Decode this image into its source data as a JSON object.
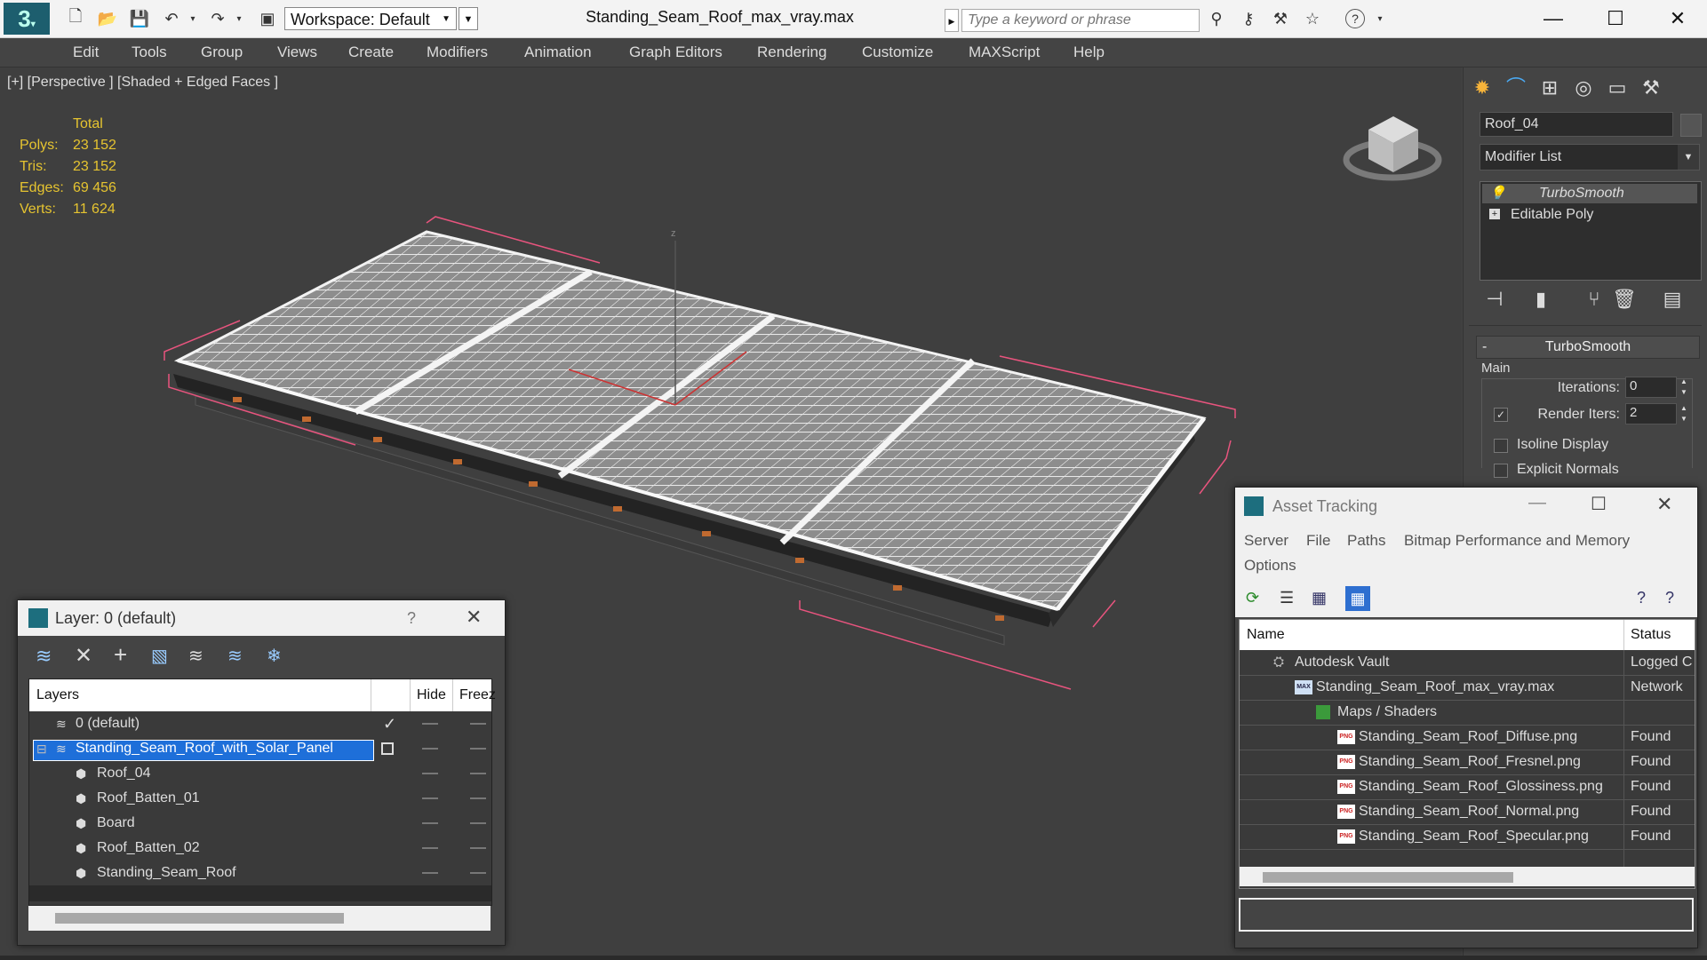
{
  "titlebar": {
    "workspace": "Workspace: Default",
    "doc_title": "Standing_Seam_Roof_max_vray.max",
    "search_placeholder": "Type a keyword or phrase"
  },
  "menu": [
    "Edit",
    "Tools",
    "Group",
    "Views",
    "Create",
    "Modifiers",
    "Animation",
    "Graph Editors",
    "Rendering",
    "Customize",
    "MAXScript",
    "Help"
  ],
  "viewport": {
    "label": "[+] [Perspective ] [Shaded + Edged Faces ]",
    "stats": {
      "header": "Total",
      "polys_label": "Polys:",
      "polys": "23 152",
      "tris_label": "Tris:",
      "tris": "23 152",
      "edges_label": "Edges:",
      "edges": "69 456",
      "verts_label": "Verts:",
      "verts": "11 624"
    },
    "axis_z": "z"
  },
  "command_panel": {
    "object_name": "Roof_04",
    "modifier_list": "Modifier List",
    "stack": [
      "TurboSmooth",
      "Editable Poly"
    ],
    "rollout_title": "TurboSmooth",
    "group_main": "Main",
    "iterations_label": "Iterations:",
    "iterations_value": "0",
    "render_iters_label": "Render Iters:",
    "render_iters_value": "2",
    "isoline_label": "Isoline Display",
    "explicit_label": "Explicit Normals"
  },
  "layer_window": {
    "title": "Layer: 0 (default)",
    "help": "?",
    "col_layers": "Layers",
    "col_hide": "Hide",
    "col_freeze": "Freez",
    "rows": [
      {
        "name": "0 (default)"
      },
      {
        "name": "Standing_Seam_Roof_with_Solar_Panel"
      },
      {
        "name": "Roof_04"
      },
      {
        "name": "Roof_Batten_01"
      },
      {
        "name": "Board"
      },
      {
        "name": "Roof_Batten_02"
      },
      {
        "name": "Standing_Seam_Roof"
      }
    ]
  },
  "asset_window": {
    "title": "Asset Tracking",
    "menu": [
      "Server",
      "File",
      "Paths",
      "Bitmap Performance and Memory",
      "Options"
    ],
    "col_name": "Name",
    "col_status": "Status",
    "rows": [
      {
        "name": "Autodesk Vault",
        "status": "Logged C",
        "icon": "PNG"
      },
      {
        "name": "Standing_Seam_Roof_max_vray.max",
        "status": "Network",
        "icon": "MAX"
      },
      {
        "name": "Maps / Shaders",
        "status": "",
        "icon": "PNG"
      },
      {
        "name": "Standing_Seam_Roof_Diffuse.png",
        "status": "Found",
        "icon": "PNG"
      },
      {
        "name": "Standing_Seam_Roof_Fresnel.png",
        "status": "Found",
        "icon": "PNG"
      },
      {
        "name": "Standing_Seam_Roof_Glossiness.png",
        "status": "Found",
        "icon": "PNG"
      },
      {
        "name": "Standing_Seam_Roof_Normal.png",
        "status": "Found",
        "icon": "PNG"
      },
      {
        "name": "Standing_Seam_Roof_Specular.png",
        "status": "Found",
        "icon": "PNG"
      }
    ]
  },
  "colors": {
    "stats_yellow": "#e6c430",
    "selection_blue": "#1e6fd9",
    "bbox_pink": "#e8547e"
  }
}
